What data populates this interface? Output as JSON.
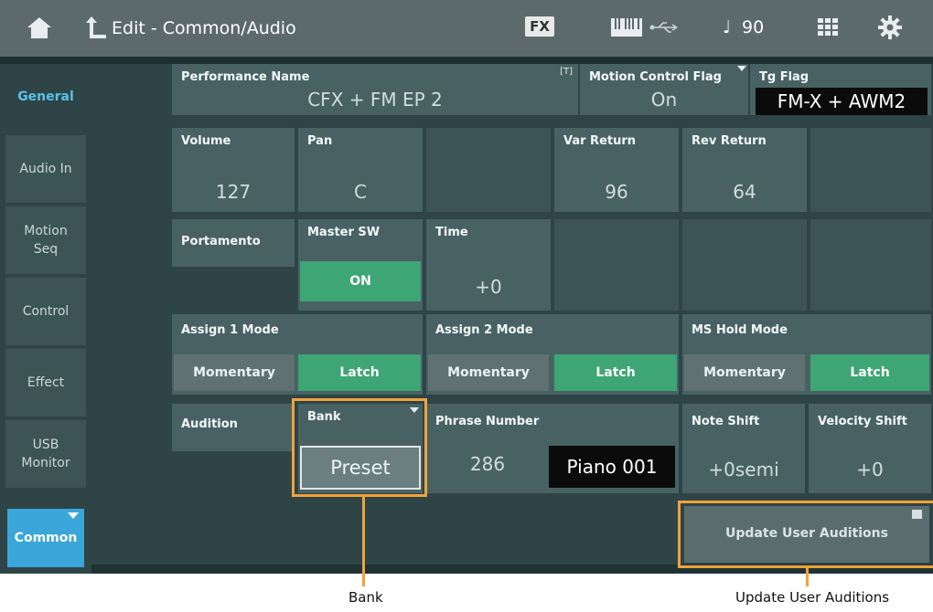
{
  "header": {
    "title": "Edit - Common/Audio",
    "fx_label": "FX",
    "tempo_value": "90",
    "tempo_prefix": "♩",
    "icons": [
      "home-icon",
      "back-icon",
      "keyboard-icon",
      "usb-icon",
      "grid-icon",
      "gear-icon"
    ]
  },
  "sidebar": {
    "tabs": [
      {
        "label": "General",
        "active": true
      },
      {
        "label": "Audio In",
        "active": false
      },
      {
        "label": "Motion\nSeq",
        "active": false
      },
      {
        "label": "Control",
        "active": false
      },
      {
        "label": "Effect",
        "active": false
      },
      {
        "label": "USB\nMonitor",
        "active": false
      }
    ],
    "common_label": "Common"
  },
  "row1": {
    "performance_name_label": "Performance Name",
    "performance_name_value": "CFX + FM EP 2",
    "text_icon": "[T]",
    "motion_control_flag_label": "Motion Control Flag",
    "motion_control_flag_value": "On",
    "tg_flag_label": "Tg Flag",
    "tg_flag_value": "FM-X + AWM2"
  },
  "row2": {
    "volume_label": "Volume",
    "volume_value": "127",
    "pan_label": "Pan",
    "pan_value": "C",
    "var_return_label": "Var Return",
    "var_return_value": "96",
    "rev_return_label": "Rev Return",
    "rev_return_value": "64"
  },
  "row3": {
    "portamento_label": "Portamento",
    "master_sw_label": "Master SW",
    "master_sw_value": "ON",
    "time_label": "Time",
    "time_value": "+0"
  },
  "row4": {
    "assign1_label": "Assign 1 Mode",
    "assign2_label": "Assign 2 Mode",
    "ms_hold_label": "MS Hold Mode",
    "momentary_label": "Momentary",
    "latch_label": "Latch"
  },
  "row5": {
    "audition_label": "Audition",
    "bank_label": "Bank",
    "bank_value": "Preset",
    "phrase_number_label": "Phrase Number",
    "phrase_number_value": "286",
    "phrase_name": "Piano 001",
    "note_shift_label": "Note Shift",
    "note_shift_value": "+0semi",
    "velocity_shift_label": "Velocity Shift",
    "velocity_shift_value": "+0"
  },
  "footer": {
    "update_label": "Update User Auditions"
  },
  "callouts": {
    "bank": "Bank",
    "update": "Update User Auditions"
  },
  "colors": {
    "accent_on": "#3ea574",
    "highlight": "#f2a33a",
    "tab_active": "#5bc0e8",
    "common_tab": "#3aa6d9"
  }
}
